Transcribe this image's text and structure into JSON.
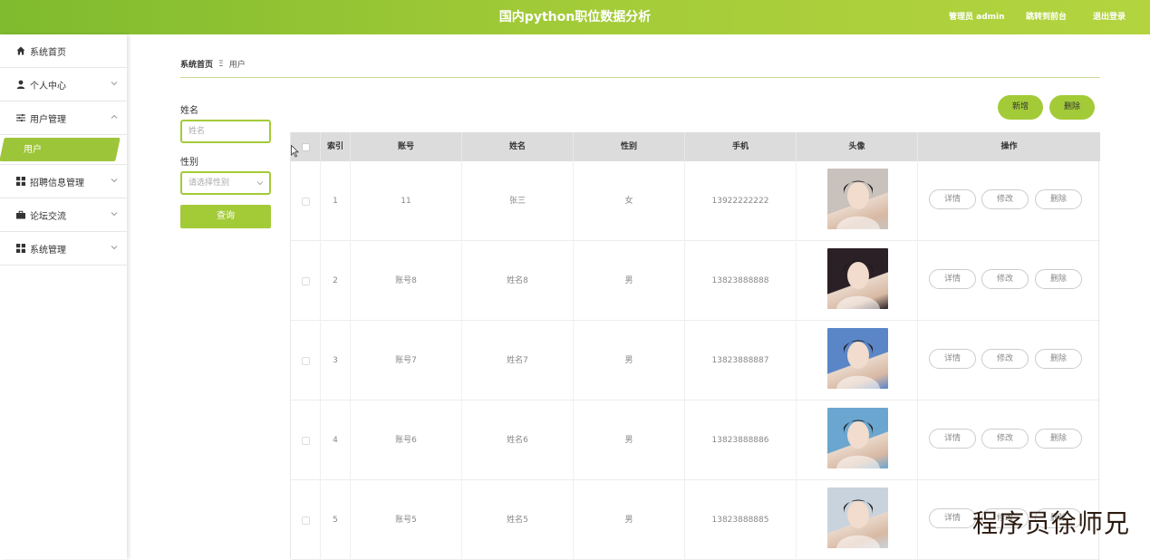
{
  "header": {
    "title": "国内python职位数据分析",
    "admin": "管理员 admin",
    "frontend": "跳转到前台",
    "logout": "退出登录"
  },
  "sidebar": {
    "items": [
      {
        "label": "系统首页",
        "icon": "home-icon"
      },
      {
        "label": "个人中心",
        "icon": "user-icon"
      },
      {
        "label": "用户管理",
        "icon": "sliders-icon"
      },
      {
        "label": "招聘信息管理",
        "icon": "grid-icon"
      },
      {
        "label": "论坛交流",
        "icon": "briefcase-icon"
      },
      {
        "label": "系统管理",
        "icon": "grid-icon"
      }
    ],
    "sub_item": "用户"
  },
  "breadcrumb": {
    "home": "系统首页",
    "sep": "Ξ",
    "current": "用户"
  },
  "search": {
    "name_label": "姓名",
    "name_placeholder": "姓名",
    "gender_label": "性别",
    "gender_placeholder": "请选择性别",
    "search_button": "查询"
  },
  "actions": {
    "add": "新增",
    "delete": "删除"
  },
  "table": {
    "headers": [
      "索引",
      "账号",
      "姓名",
      "性别",
      "手机",
      "头像",
      "操作"
    ],
    "ops": [
      "详情",
      "修改",
      "删除"
    ],
    "rows": [
      {
        "index": "1",
        "account": "11",
        "name": "张三",
        "gender": "女",
        "phone": "13922222222",
        "avatar_color": "#c9c2bc"
      },
      {
        "index": "2",
        "account": "账号8",
        "name": "姓名8",
        "gender": "男",
        "phone": "13823888888",
        "avatar_color": "#2a2026"
      },
      {
        "index": "3",
        "account": "账号7",
        "name": "姓名7",
        "gender": "男",
        "phone": "13823888887",
        "avatar_color": "#5a86c8"
      },
      {
        "index": "4",
        "account": "账号6",
        "name": "姓名6",
        "gender": "男",
        "phone": "13823888886",
        "avatar_color": "#6aa6cf"
      },
      {
        "index": "5",
        "account": "账号5",
        "name": "姓名5",
        "gender": "男",
        "phone": "13823888885",
        "avatar_color": "#c9d3dd"
      }
    ]
  },
  "watermark": "程序员徐师兄",
  "colors": {
    "accent": "#a3cb38",
    "header_start": "#7fbb2e"
  }
}
